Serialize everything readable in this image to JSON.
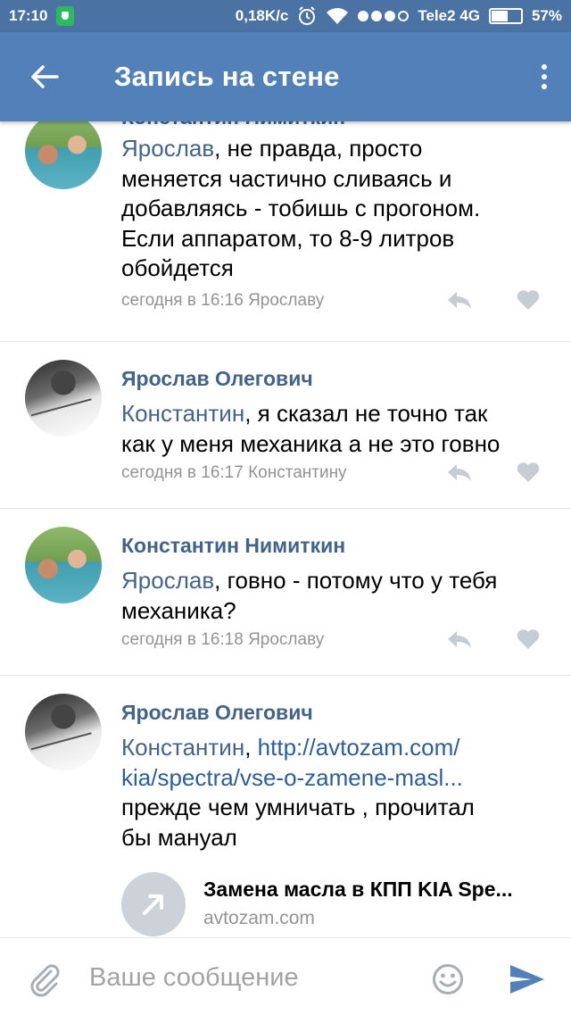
{
  "status_bar": {
    "time": "17:10",
    "speed": "0,18K/c",
    "carrier": "Tele2 4G",
    "battery": "57%",
    "battery_level": 0.57
  },
  "header": {
    "title": "Запись на стене"
  },
  "comments": [
    {
      "author": "Константин Нимиткин",
      "mention": "Ярослав",
      "lines": [
        ", не правда, просто",
        "меняется частично сливаясь и",
        "добавляясь - тобишь с прогоном.",
        "Если аппаратом, то 8-9 литров",
        "обойдется"
      ],
      "meta": "сегодня в 16:16 Ярославу"
    },
    {
      "author": "Ярослав Олегович",
      "mention": "Константин",
      "lines": [
        ", я сказал не точно так",
        "как у меня механика а не это говно"
      ],
      "meta": "сегодня в 16:17 Константину"
    },
    {
      "author": "Константин Нимиткин",
      "mention": "Ярослав",
      "lines": [
        ", говно - потому что у тебя",
        "механика?"
      ],
      "meta": "сегодня в 16:18 Ярославу"
    },
    {
      "author": "Ярослав Олегович",
      "mention": "Константин",
      "separator": ", ",
      "link_lines": [
        "http://avtozam.com/",
        "kia/spectra/vse-o-zamene-masl..."
      ],
      "lines": [
        "прежде чем умничать , прочитал",
        "бы мануал"
      ],
      "attachment": {
        "title": "Замена масла в КПП KIA Spe...",
        "domain": "avtozam.com"
      }
    }
  ],
  "composer": {
    "placeholder": "Ваше сообщение"
  },
  "colors": {
    "status_bar": "#4a73a4",
    "app_bar": "#5181b8",
    "author_blue": "#42648b",
    "meta_gray": "#939393",
    "send_blue": "#5181b8"
  }
}
